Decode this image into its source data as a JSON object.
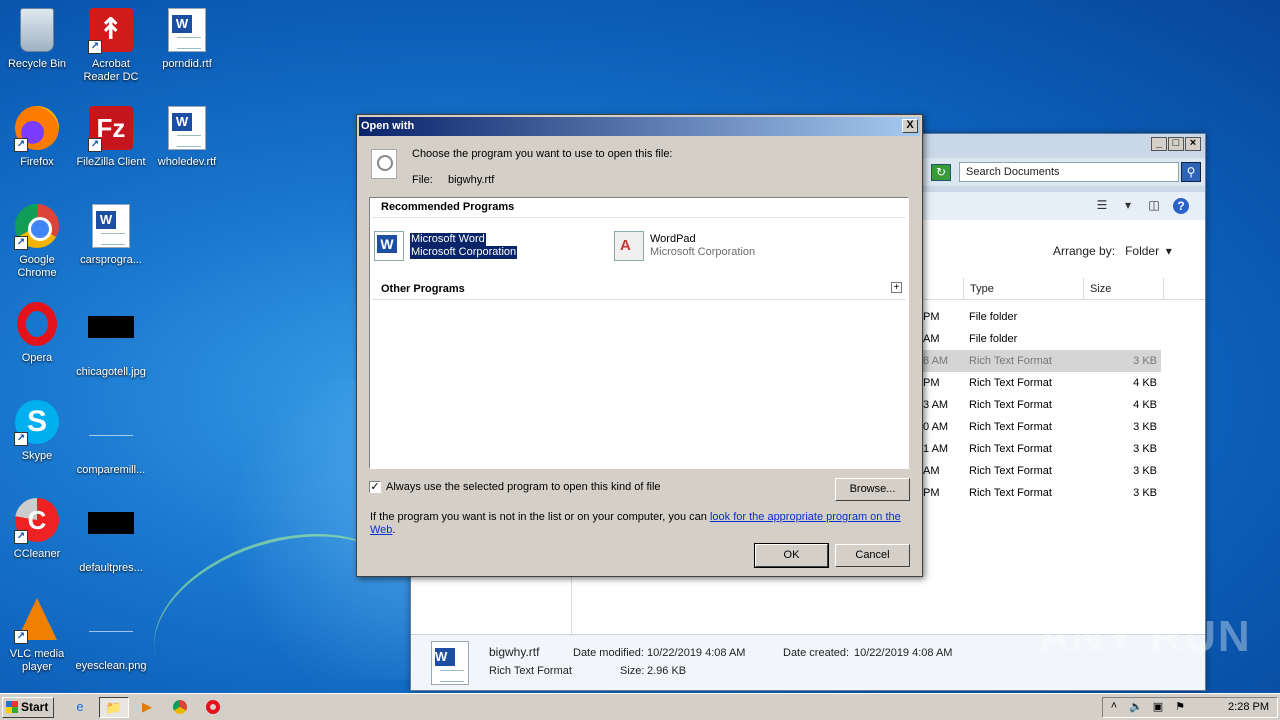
{
  "desktop": {
    "icons": [
      {
        "label": "Recycle Bin",
        "icon": "recycle-bin-icon"
      },
      {
        "label": "Acrobat Reader DC",
        "icon": "acrobat-icon"
      },
      {
        "label": "porndid.rtf",
        "icon": "word-document-icon"
      },
      {
        "label": "Firefox",
        "icon": "firefox-icon"
      },
      {
        "label": "FileZilla Client",
        "icon": "filezilla-icon"
      },
      {
        "label": "wholedev.rtf",
        "icon": "word-document-icon"
      },
      {
        "label": "Google Chrome",
        "icon": "chrome-icon"
      },
      {
        "label": "carsprogra...",
        "icon": "word-document-icon"
      },
      {
        "label": "Opera",
        "icon": "opera-icon"
      },
      {
        "label": "chicagotell.jpg",
        "icon": "image-file-icon"
      },
      {
        "label": "Skype",
        "icon": "skype-icon"
      },
      {
        "label": "comparemill...",
        "icon": "file-icon"
      },
      {
        "label": "CCleaner",
        "icon": "ccleaner-icon"
      },
      {
        "label": "defaultpres...",
        "icon": "image-file-icon"
      },
      {
        "label": "VLC media player",
        "icon": "vlc-icon"
      },
      {
        "label": "eyesclean.png",
        "icon": "image-file-icon"
      }
    ]
  },
  "explorer": {
    "search_placeholder": "Search Documents",
    "arrange_label": "Arrange by:",
    "arrange_value": "Folder",
    "columns": [
      "Type",
      "Size"
    ],
    "rows": [
      {
        "time": "PM",
        "type": "File folder",
        "size": ""
      },
      {
        "time": "AM",
        "type": "File folder",
        "size": ""
      },
      {
        "time": "8 AM",
        "type": "Rich Text Format",
        "size": "3 KB"
      },
      {
        "time": "PM",
        "type": "Rich Text Format",
        "size": "4 KB"
      },
      {
        "time": "3 AM",
        "type": "Rich Text Format",
        "size": "4 KB"
      },
      {
        "time": "0 AM",
        "type": "Rich Text Format",
        "size": "3 KB"
      },
      {
        "time": "1 AM",
        "type": "Rich Text Format",
        "size": "3 KB"
      },
      {
        "time": "AM",
        "type": "Rich Text Format",
        "size": "3 KB"
      },
      {
        "time": "PM",
        "type": "Rich Text Format",
        "size": "3 KB"
      }
    ],
    "details": {
      "filename": "bigwhy.rtf",
      "filetype": "Rich Text Format",
      "date_modified_label": "Date modified:",
      "date_modified": "10/22/2019 4:08 AM",
      "date_created_label": "Date created:",
      "date_created": "10/22/2019 4:08 AM",
      "size_label": "Size:",
      "size": "2.96 KB"
    }
  },
  "dialog": {
    "title": "Open with",
    "close": "X",
    "prompt": "Choose the program you want to use to open this file:",
    "file_label": "File:",
    "file_name": "bigwhy.rtf",
    "recommended_header": "Recommended Programs",
    "other_header": "Other Programs",
    "expand": "+",
    "programs": [
      {
        "name": "Microsoft Word",
        "publisher": "Microsoft Corporation"
      },
      {
        "name": "WordPad",
        "publisher": "Microsoft Corporation"
      }
    ],
    "always_use_label": "Always use the selected program to open this kind of file",
    "always_use_checked": "✓",
    "browse_label": "Browse...",
    "help_text_1": "If the program you want is not in the list or on your computer, you can",
    "help_link": "look for the appropriate program on the",
    "help_link_2": "Web",
    "help_text_end": ".",
    "ok_label": "OK",
    "cancel_label": "Cancel"
  },
  "taskbar": {
    "start_label": "Start",
    "apps": [
      "ie-icon",
      "explorer-icon",
      "media-player-icon",
      "chrome-icon",
      "opera-icon"
    ],
    "clock": "2:28 PM"
  },
  "watermark": "ANY RUN"
}
